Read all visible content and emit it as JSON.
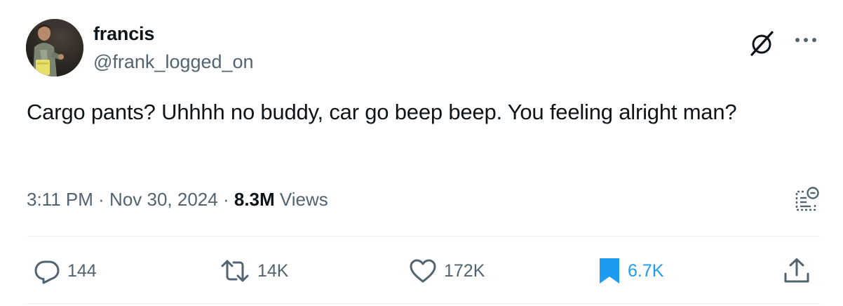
{
  "author": {
    "display_name": "francis",
    "handle": "@frank_logged_on",
    "avatar_icon": "profile-photo"
  },
  "header_icons": {
    "grok": "grok-icon",
    "more": "more-icon"
  },
  "tweet": {
    "text": "Cargo pants? Uhhhh no buddy, car go beep beep. You feeling alright man?",
    "time": "3:11 PM",
    "separator": "·",
    "date": "Nov 30, 2024",
    "views_count": "8.3M",
    "views_label": "Views"
  },
  "actions": {
    "reply": "144",
    "repost": "14K",
    "like": "172K",
    "bookmark": "6.7K"
  },
  "colors": {
    "text": "#0f1419",
    "secondary": "#536471",
    "accent": "#1d9bf0",
    "divider": "#eff3f4"
  }
}
